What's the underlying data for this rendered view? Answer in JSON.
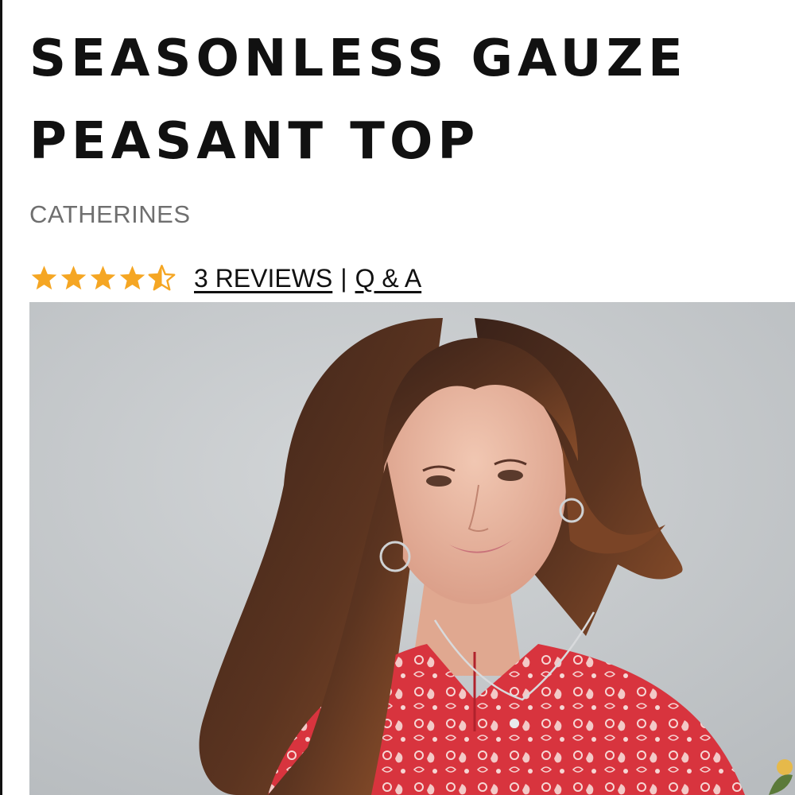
{
  "product": {
    "title": "SEASONLESS GAUZE PEASANT TOP",
    "brand": "CATHERINES"
  },
  "rating": {
    "stars": 4.5,
    "max_stars": 5,
    "star_color": "#f5a623",
    "reviews_label": "3 REVIEWS",
    "separator": "|",
    "qa_label": "Q & A"
  },
  "hero_image": {
    "background_color": "#c9ccce",
    "top_color": "#d8343e"
  }
}
